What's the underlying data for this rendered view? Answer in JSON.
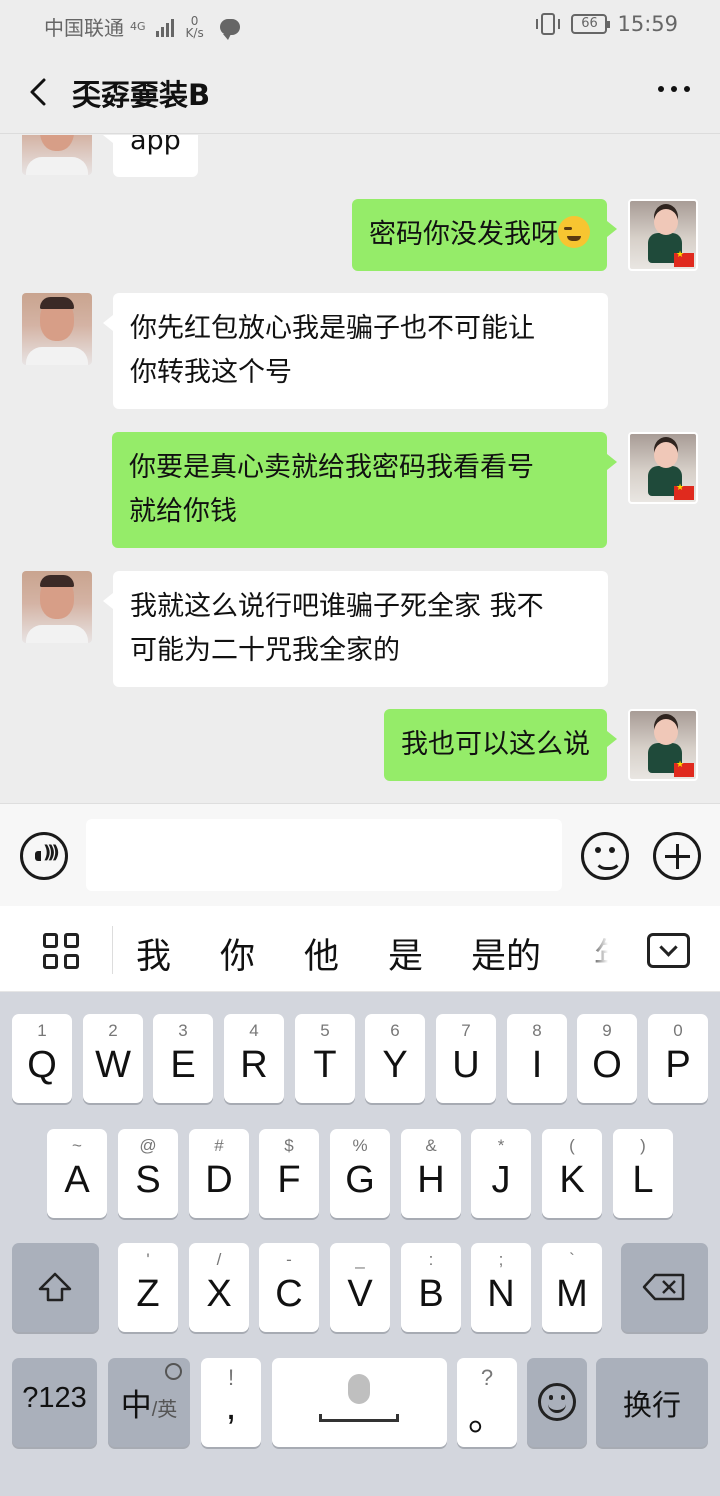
{
  "status_bar": {
    "carrier": "中国联通",
    "network_type": "4G",
    "net_speed_value": "0",
    "net_speed_unit": "K/s",
    "battery": "66",
    "time": "15:59"
  },
  "header": {
    "title": "奀孬嫑装B"
  },
  "messages": [
    {
      "side": "left",
      "text": "app"
    },
    {
      "side": "right",
      "text": "密码你没发我呀"
    },
    {
      "side": "left",
      "text_lines": [
        "你先红包放心我是骗子也不可能让",
        "你转我这个号"
      ]
    },
    {
      "side": "right",
      "text_lines": [
        "你要是真心卖就给我密码我看看号",
        "就给你钱"
      ]
    },
    {
      "side": "left",
      "text_lines": [
        "我就这么说行吧谁骗子死全家 我不",
        "可能为二十咒我全家的"
      ]
    },
    {
      "side": "right",
      "text": "我也可以这么说"
    }
  ],
  "input_bar": {
    "placeholder": ""
  },
  "candidates": [
    "我",
    "你",
    "他",
    "是",
    "是的",
    "年"
  ],
  "keyboard": {
    "row1": [
      {
        "hint": "1",
        "key": "Q"
      },
      {
        "hint": "2",
        "key": "W"
      },
      {
        "hint": "3",
        "key": "E"
      },
      {
        "hint": "4",
        "key": "R"
      },
      {
        "hint": "5",
        "key": "T"
      },
      {
        "hint": "6",
        "key": "Y"
      },
      {
        "hint": "7",
        "key": "U"
      },
      {
        "hint": "8",
        "key": "I"
      },
      {
        "hint": "9",
        "key": "O"
      },
      {
        "hint": "0",
        "key": "P"
      }
    ],
    "row2": [
      {
        "hint": "~",
        "key": "A"
      },
      {
        "hint": "@",
        "key": "S"
      },
      {
        "hint": "#",
        "key": "D"
      },
      {
        "hint": "$",
        "key": "F"
      },
      {
        "hint": "%",
        "key": "G"
      },
      {
        "hint": "&",
        "key": "H"
      },
      {
        "hint": "*",
        "key": "J"
      },
      {
        "hint": "(",
        "key": "K"
      },
      {
        "hint": ")",
        "key": "L"
      }
    ],
    "row3": [
      {
        "hint": "'",
        "key": "Z"
      },
      {
        "hint": "/",
        "key": "X"
      },
      {
        "hint": "-",
        "key": "C"
      },
      {
        "hint": "_",
        "key": "V"
      },
      {
        "hint": ":",
        "key": "B"
      },
      {
        "hint": ";",
        "key": "N"
      },
      {
        "hint": "`",
        "key": "M"
      }
    ],
    "numbers_label": "?123",
    "lang_main": "中",
    "lang_sub": "/英",
    "comma_hint": "!",
    "comma": ",",
    "period_hint": "?",
    "period": "。",
    "enter_label": "换行"
  }
}
